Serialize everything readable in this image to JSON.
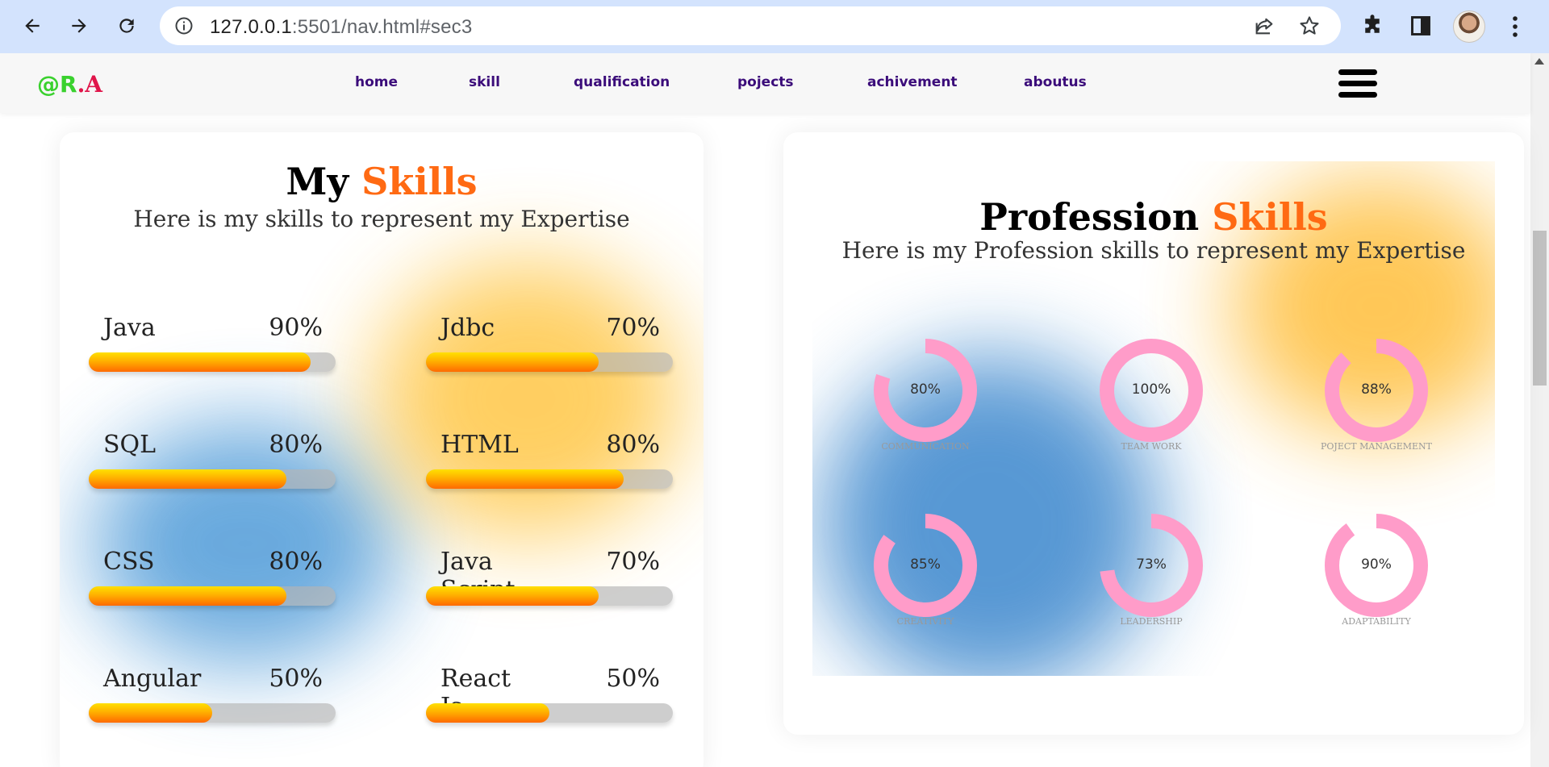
{
  "browser": {
    "url_host": "127.0.0.1",
    "url_rest": ":5501/nav.html#sec3"
  },
  "site": {
    "logo_part1": "@R",
    "logo_part2": ".A",
    "nav": [
      "home",
      "skill",
      "qualification",
      "pojects",
      "achivement",
      "aboutus"
    ]
  },
  "skills_card": {
    "title_plain": "My",
    "title_accent": "Skills",
    "subtitle": "Here is my skills to represent my Expertise",
    "skills": [
      {
        "name": "Java",
        "percent_label": "90%",
        "value": 90
      },
      {
        "name": "Jdbc",
        "percent_label": "70%",
        "value": 70
      },
      {
        "name": "SQL",
        "percent_label": "80%",
        "value": 80
      },
      {
        "name": "HTML",
        "percent_label": "80%",
        "value": 80
      },
      {
        "name": "CSS",
        "percent_label": "80%",
        "value": 80
      },
      {
        "name": "Java Script",
        "percent_label": "70%",
        "value": 70
      },
      {
        "name": "Angular",
        "percent_label": "50%",
        "value": 50
      },
      {
        "name": "React Js",
        "percent_label": "50%",
        "value": 50
      }
    ]
  },
  "profession_card": {
    "title_plain": "Profession",
    "title_accent": "Skills",
    "subtitle": "Here is my Profession skills to represent my Expertise",
    "skills": [
      {
        "name": "COMMUNICATION",
        "percent_label": "80%",
        "value": 80
      },
      {
        "name": "TEAM WORK",
        "percent_label": "100%",
        "value": 100
      },
      {
        "name": "POJECT MANAGEMENT",
        "percent_label": "88%",
        "value": 88
      },
      {
        "name": "CREATIVITY",
        "percent_label": "85%",
        "value": 85
      },
      {
        "name": "LEADERSHIP",
        "percent_label": "73%",
        "value": 73
      },
      {
        "name": "ADAPTABILITY",
        "percent_label": "90%",
        "value": 90
      }
    ]
  },
  "colors": {
    "accent": "#ff6a13",
    "nav_link": "#3b0c7a",
    "ring": "#ff9cc9"
  }
}
